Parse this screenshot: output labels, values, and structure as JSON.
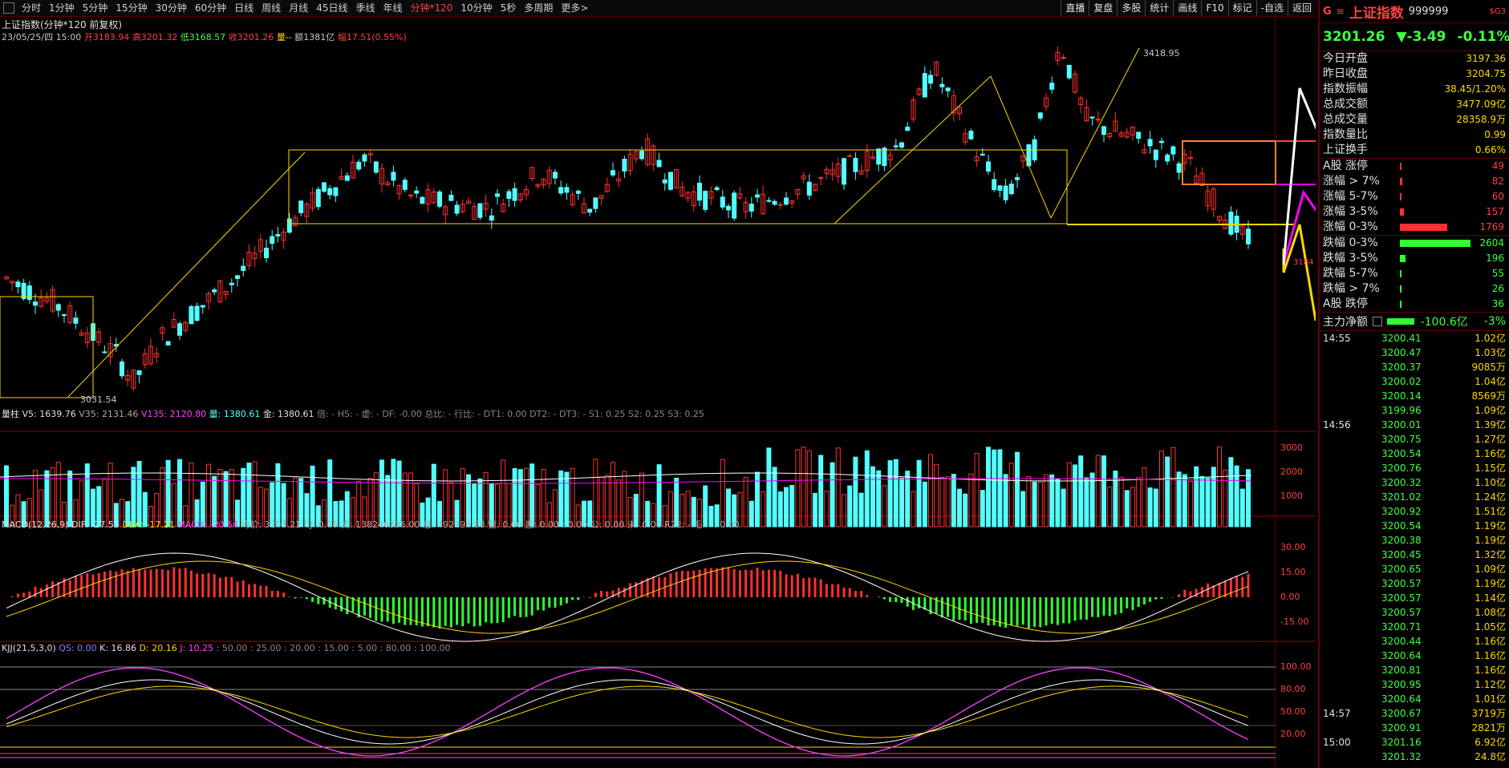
{
  "toolbar": {
    "items": [
      "分时",
      "1分钟",
      "5分钟",
      "15分钟",
      "30分钟",
      "60分钟",
      "日线",
      "周线",
      "月线",
      "45日线",
      "季线",
      "年线",
      "分钟*120",
      "10分钟",
      "5秒",
      "多周期",
      "更多>"
    ],
    "active_index": 12,
    "right_items": [
      "直播",
      "复盘",
      "多股",
      "统计",
      "画线",
      "F10",
      "标记",
      "-自选",
      "返回"
    ]
  },
  "chart": {
    "title": "上证指数(分钟*120 前复权)",
    "date": "23/05/25/四 15:00",
    "open": "开3183.94",
    "high": "高3201.32",
    "low": "低3168.57",
    "close": "收3201.26",
    "vol": "量--",
    "amount": "额1381亿",
    "change": "幅17.51(0.55%)",
    "high_label": "3418.95",
    "low_label": "3031.54",
    "right_label": "3184"
  },
  "volume_panel": {
    "label": "量柱",
    "v5": "V5: 1639.76",
    "v35": "V35: 2131.46",
    "v135": "V135: 2120.80",
    "liang": "量: 1380.61",
    "jin": "金: 1380.61",
    "rest": "倍: -  HS: -  虚: -  DF: -0.00  总比: -  行比: -  DT1: 0.00  DT2: -  DT3: -  S1: 0.25  S2: 0.25  S3: 0.25",
    "axis": [
      "3000",
      "2000",
      "1000"
    ]
  },
  "macd_panel": {
    "label": "MACD(12,26,9)",
    "dif": "DIF: -27.53",
    "dea": "DEA: -17.21",
    "macd": "MACD: -20.64",
    "rest": "均价: 3203.21  CJ: 0.06  流: 138246336.00  总: 492296.88  营: 0.00  担: 0.00 : 0.00  公: 0.00  未: 0.00  R22: -  毛: - : 0.00",
    "axis": [
      "30.00",
      "15.00",
      "0.00",
      "-15.00"
    ]
  },
  "kdj_panel": {
    "label": "KJJ(21,5,3,0)",
    "qs": "QS: 0.00",
    "k": "K: 16.86",
    "d": "D: 20.16",
    "j": "J: 10.25",
    "rest": ": 50.00 : 25.00 : 20.00 : 15.00 : 5.00 : 80.00 : 100.00",
    "axis": [
      "100.00",
      "80.00",
      "50.00",
      "20.00"
    ]
  },
  "right_panel": {
    "g": "G",
    "eq": "≡",
    "name": "上证指数",
    "code": "999999",
    "sig": "$G3",
    "price": "3201.26",
    "change": "▼-3.49",
    "pct": "-0.11%",
    "stats": [
      {
        "label": "今日开盘",
        "value": "3197.36"
      },
      {
        "label": "昨日收盘",
        "value": "3204.75"
      },
      {
        "label": "指数振幅",
        "value": "38.45/1.20%"
      },
      {
        "label": "总成交额",
        "value": "3477.09亿"
      },
      {
        "label": "总成交量",
        "value": "28358.9万"
      },
      {
        "label": "指数量比",
        "value": "0.99"
      },
      {
        "label": "上证换手",
        "value": "0.66%"
      }
    ],
    "up_dist": [
      {
        "label": "A股 涨停",
        "value": "49",
        "ratio": 0.02
      },
      {
        "label": "涨幅 > 7%",
        "value": "82",
        "ratio": 0.03
      },
      {
        "label": "涨幅 5-7%",
        "value": "60",
        "ratio": 0.025
      },
      {
        "label": "涨幅 3-5%",
        "value": "157",
        "ratio": 0.06
      },
      {
        "label": "涨幅 0-3%",
        "value": "1769",
        "ratio": 0.67
      }
    ],
    "down_dist": [
      {
        "label": "跌幅 0-3%",
        "value": "2604",
        "ratio": 1.0
      },
      {
        "label": "跌幅 3-5%",
        "value": "196",
        "ratio": 0.075
      },
      {
        "label": "跌幅 5-7%",
        "value": "55",
        "ratio": 0.02
      },
      {
        "label": "跌幅 > 7%",
        "value": "26",
        "ratio": 0.01
      },
      {
        "label": "A股 跌停",
        "value": "36",
        "ratio": 0.014
      }
    ],
    "net_label": "主力净额",
    "net_value": "-100.6亿",
    "net_pct": "-3%",
    "ticks": [
      {
        "time": "14:55",
        "price": "3200.41",
        "amount": "1.02亿"
      },
      {
        "time": "",
        "price": "3200.47",
        "amount": "1.03亿"
      },
      {
        "time": "",
        "price": "3200.37",
        "amount": "9085万"
      },
      {
        "time": "",
        "price": "3200.02",
        "amount": "1.04亿"
      },
      {
        "time": "",
        "price": "3200.14",
        "amount": "8569万"
      },
      {
        "time": "",
        "price": "3199.96",
        "amount": "1.09亿"
      },
      {
        "time": "14:56",
        "price": "3200.01",
        "amount": "1.39亿"
      },
      {
        "time": "",
        "price": "3200.75",
        "amount": "1.27亿"
      },
      {
        "time": "",
        "price": "3200.54",
        "amount": "1.16亿"
      },
      {
        "time": "",
        "price": "3200.76",
        "amount": "1.15亿"
      },
      {
        "time": "",
        "price": "3200.32",
        "amount": "1.10亿"
      },
      {
        "time": "",
        "price": "3201.02",
        "amount": "1.24亿"
      },
      {
        "time": "",
        "price": "3200.92",
        "amount": "1.51亿"
      },
      {
        "time": "",
        "price": "3200.54",
        "amount": "1.19亿"
      },
      {
        "time": "",
        "price": "3200.38",
        "amount": "1.19亿"
      },
      {
        "time": "",
        "price": "3200.45",
        "amount": "1.32亿"
      },
      {
        "time": "",
        "price": "3200.65",
        "amount": "1.09亿"
      },
      {
        "time": "",
        "price": "3200.57",
        "amount": "1.19亿"
      },
      {
        "time": "",
        "price": "3200.57",
        "amount": "1.14亿"
      },
      {
        "time": "",
        "price": "3200.57",
        "amount": "1.08亿"
      },
      {
        "time": "",
        "price": "3200.71",
        "amount": "1.05亿"
      },
      {
        "time": "",
        "price": "3200.44",
        "amount": "1.16亿"
      },
      {
        "time": "",
        "price": "3200.64",
        "amount": "1.16亿"
      },
      {
        "time": "",
        "price": "3200.81",
        "amount": "1.16亿"
      },
      {
        "time": "",
        "price": "3200.95",
        "amount": "1.12亿"
      },
      {
        "time": "",
        "price": "3200.64",
        "amount": "1.01亿"
      },
      {
        "time": "14:57",
        "price": "3200.67",
        "amount": "3719万"
      },
      {
        "time": "",
        "price": "3200.91",
        "amount": "2821万"
      },
      {
        "time": "15:00",
        "price": "3201.16",
        "amount": "6.92亿"
      },
      {
        "time": "",
        "price": "3201.32",
        "amount": "24.8亿"
      }
    ]
  },
  "colors": {
    "up": "#ff3030",
    "down": "#54ffff",
    "vol_up": "#ff3030",
    "macd_neg": "#30ff30",
    "macd_pos": "#ff3030",
    "yellow": "#ffd700",
    "magenta": "#ff00ff"
  }
}
